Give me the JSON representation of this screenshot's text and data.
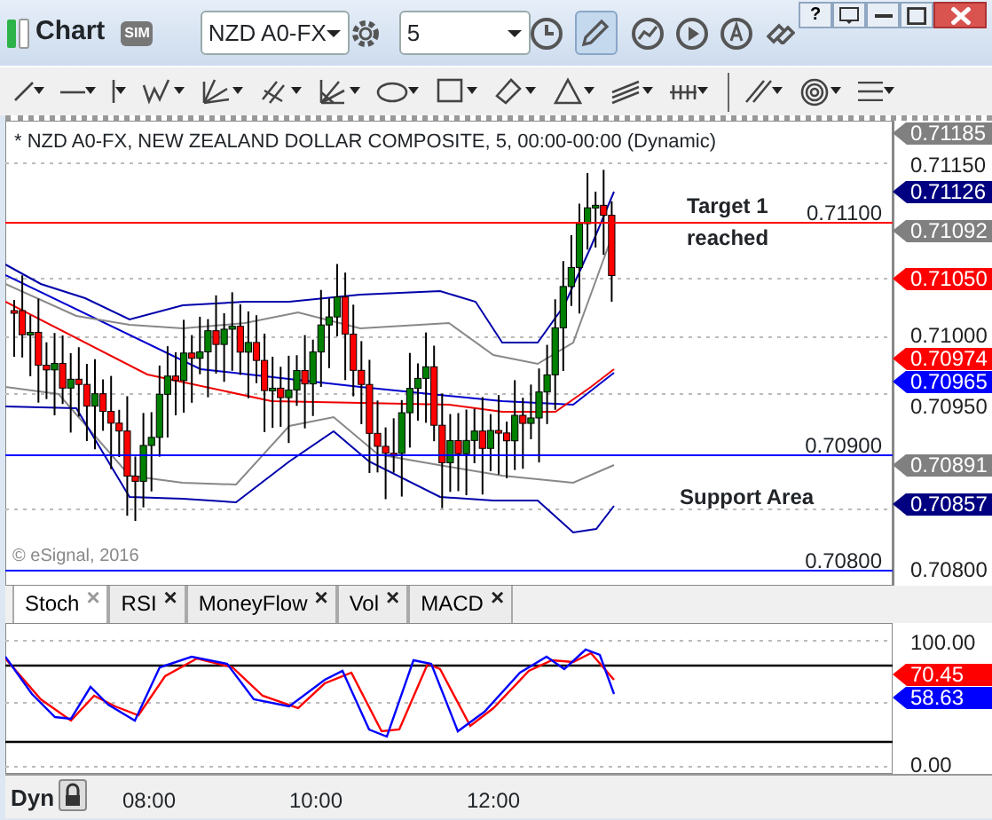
{
  "window": {
    "title": "Chart",
    "badge": "SIM",
    "help": "?"
  },
  "toolbar": {
    "symbol": "NZD A0-FX",
    "interval": "5",
    "pencil_selected": true
  },
  "chart": {
    "header": "* NZD A0-FX, NEW ZEALAND DOLLAR COMPOSITE, 5, 00:00-00:00 (Dynamic)",
    "copyright": "© eSignal, 2016",
    "levels": [
      {
        "label": "0.71100",
        "color": "#ff0000"
      },
      {
        "label": "0.70900",
        "color": "#0000ff"
      },
      {
        "label": "0.70800",
        "color": "#0000ff"
      }
    ],
    "annotations": [
      "Target 1 reached",
      "Support Area"
    ],
    "price_labels": [
      {
        "text": "0.71185",
        "kind": "tag",
        "color": "#808080"
      },
      {
        "text": "0.71150",
        "kind": "plain"
      },
      {
        "text": "0.71126",
        "kind": "tag",
        "color": "#000080"
      },
      {
        "text": "0.71092",
        "kind": "tag",
        "color": "#808080"
      },
      {
        "text": "0.71050",
        "kind": "tag",
        "color": "#ff0000"
      },
      {
        "text": "0.71000",
        "kind": "plain"
      },
      {
        "text": "0.70974",
        "kind": "tag",
        "color": "#ff0000"
      },
      {
        "text": "0.70965",
        "kind": "tag",
        "color": "#0000ff"
      },
      {
        "text": "0.70950",
        "kind": "plain"
      },
      {
        "text": "0.70891",
        "kind": "tag",
        "color": "#808080"
      },
      {
        "text": "0.70857",
        "kind": "tag",
        "color": "#000080"
      },
      {
        "text": "0.70800",
        "kind": "plain"
      }
    ]
  },
  "indicator_tabs": [
    {
      "label": "Stoch",
      "close": "×",
      "selected": true
    },
    {
      "label": "RSI",
      "close": "×",
      "selected": false
    },
    {
      "label": "MoneyFlow",
      "close": "×",
      "selected": false
    },
    {
      "label": "Vol",
      "close": "×",
      "selected": false
    },
    {
      "label": "MACD",
      "close": "×",
      "selected": false
    }
  ],
  "indicator": {
    "axis_labels": [
      {
        "text": "100.00",
        "kind": "plain"
      },
      {
        "text": "70.45",
        "kind": "tag",
        "color": "#ff0000"
      },
      {
        "text": "58.63",
        "kind": "tag",
        "color": "#0000ff"
      },
      {
        "text": "0.00",
        "kind": "plain"
      }
    ]
  },
  "time_axis": {
    "mode": "Dyn",
    "times": [
      "08:00",
      "10:00",
      "12:00"
    ]
  }
}
